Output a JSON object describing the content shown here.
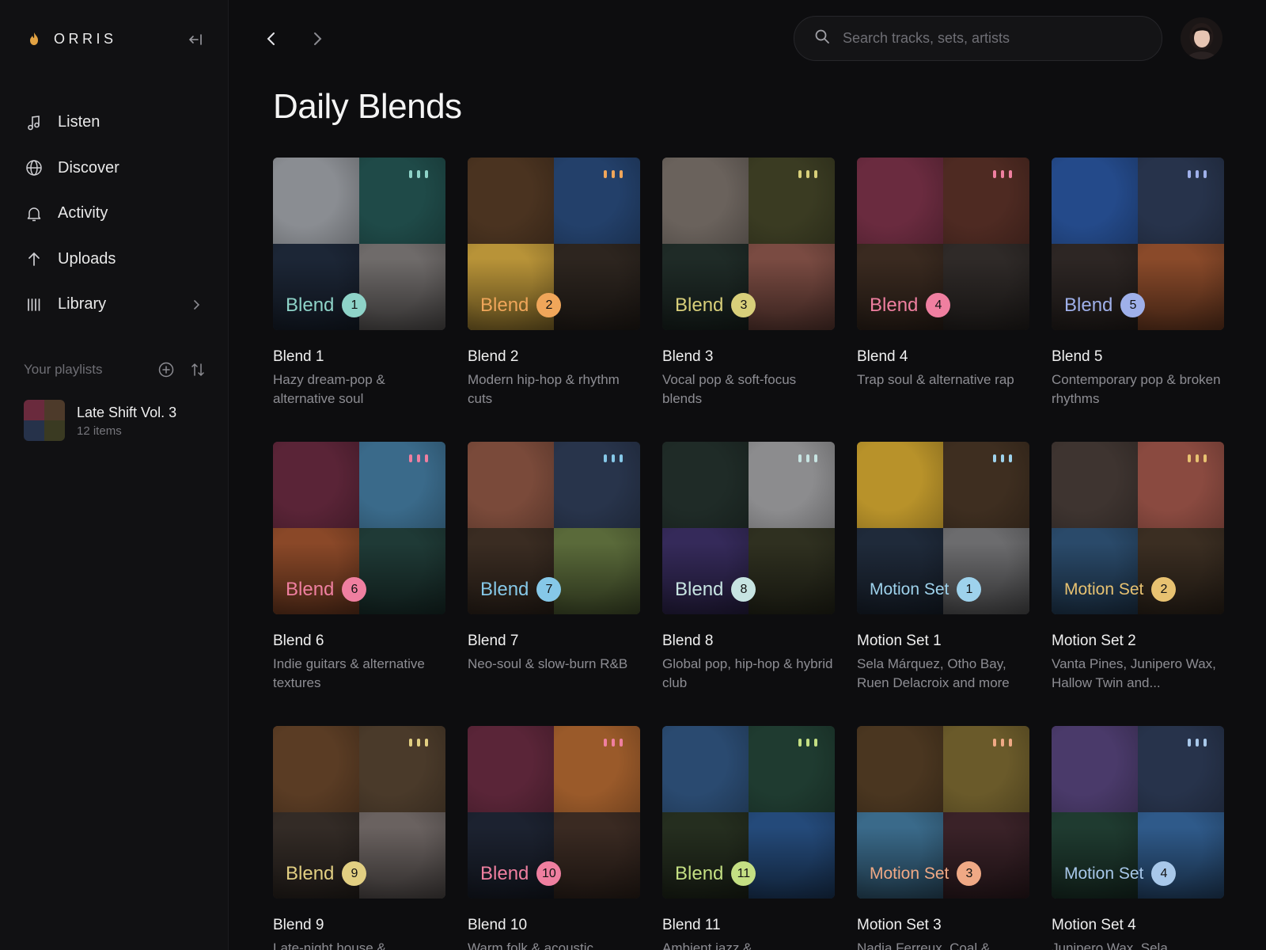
{
  "app": {
    "name": "ORRIS"
  },
  "sidebar": {
    "nav": [
      {
        "label": "Listen",
        "icon": "music-note-icon"
      },
      {
        "label": "Discover",
        "icon": "globe-icon"
      },
      {
        "label": "Activity",
        "icon": "bell-icon"
      },
      {
        "label": "Uploads",
        "icon": "arrow-up-icon"
      },
      {
        "label": "Library",
        "icon": "library-icon"
      }
    ],
    "playlists_title": "Your playlists",
    "playlists": [
      {
        "name": "Late Shift Vol. 3",
        "count": "12 items"
      }
    ]
  },
  "search": {
    "placeholder": "Search tracks, sets, artists"
  },
  "page": {
    "title": "Daily Blends"
  },
  "cards": [
    {
      "title": "Blend 1",
      "desc": "Hazy dream-pop & alternative soul",
      "word": "Blend",
      "num": "1",
      "accent": "#8ed3c8"
    },
    {
      "title": "Blend 2",
      "desc": "Modern hip-hop & rhythm cuts",
      "word": "Blend",
      "num": "2",
      "accent": "#f0a65a"
    },
    {
      "title": "Blend 3",
      "desc": "Vocal pop & soft-focus blends",
      "word": "Blend",
      "num": "3",
      "accent": "#d8cf7a"
    },
    {
      "title": "Blend 4",
      "desc": "Trap soul & alternative rap",
      "word": "Blend",
      "num": "4",
      "accent": "#ef7fa0"
    },
    {
      "title": "Blend 5",
      "desc": "Contemporary pop & broken rhythms",
      "word": "Blend",
      "num": "5",
      "accent": "#9fb0ea"
    },
    {
      "title": "Blend 6",
      "desc": "Indie guitars & alternative textures",
      "word": "Blend",
      "num": "6",
      "accent": "#ef7fa0"
    },
    {
      "title": "Blend 7",
      "desc": "Neo-soul & slow-burn R&B",
      "word": "Blend",
      "num": "7",
      "accent": "#86c8e8"
    },
    {
      "title": "Blend 8",
      "desc": "Global pop, hip-hop & hybrid club",
      "word": "Blend",
      "num": "8",
      "accent": "#c7e4e2"
    },
    {
      "title": "Motion Set 1",
      "desc": "Sela Márquez, Otho Bay, Ruen Delacroix and more",
      "word": "Motion Set",
      "num": "1",
      "accent": "#9ed2ec"
    },
    {
      "title": "Motion Set 2",
      "desc": "Vanta Pines, Junipero Wax, Hallow Twin and...",
      "word": "Motion Set",
      "num": "2",
      "accent": "#e8c271"
    },
    {
      "title": "Blend 9",
      "desc": "Late-night house &",
      "word": "Blend",
      "num": "9",
      "accent": "#e2cf82"
    },
    {
      "title": "Blend 10",
      "desc": "Warm folk & acoustic",
      "word": "Blend",
      "num": "10",
      "accent": "#ef7fa0"
    },
    {
      "title": "Blend 11",
      "desc": "Ambient jazz &",
      "word": "Blend",
      "num": "11",
      "accent": "#c4df83"
    },
    {
      "title": "Motion Set 3",
      "desc": "Nadia Ferreux, Coal &",
      "word": "Motion Set",
      "num": "3",
      "accent": "#f0a985"
    },
    {
      "title": "Motion Set 4",
      "desc": "Junipero Wax, Sela",
      "word": "Motion Set",
      "num": "4",
      "accent": "#a8c8ea"
    }
  ]
}
